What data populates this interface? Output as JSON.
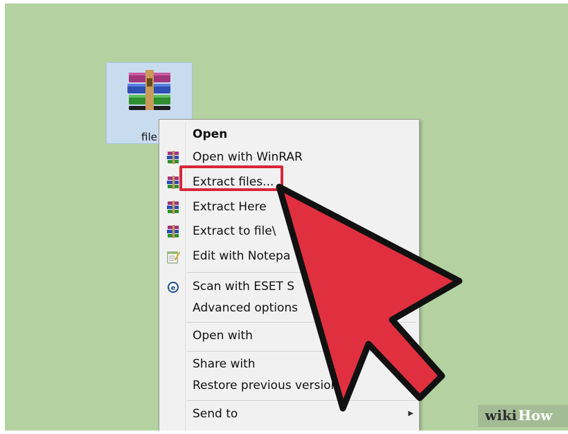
{
  "file": {
    "label": "file",
    "icon": "winrar-archive-icon"
  },
  "context_menu": {
    "items": [
      {
        "label": "Open",
        "bold": true,
        "icon": ""
      },
      {
        "label": "Open with WinRAR",
        "icon": "winrar-icon"
      },
      {
        "label": "Extract files...",
        "icon": "winrar-icon",
        "highlighted": true
      },
      {
        "label": "Extract Here",
        "icon": "winrar-icon"
      },
      {
        "label": "Extract to file\\",
        "icon": "winrar-icon"
      },
      {
        "label": "Edit with Notepa",
        "icon": "notepad-icon"
      },
      {
        "label": "Scan with ESET S",
        "icon": "eset-icon"
      },
      {
        "label": "Advanced options",
        "icon": "",
        "submenu": true
      },
      {
        "label": "Open with",
        "icon": ""
      },
      {
        "label": "Share with",
        "icon": ""
      },
      {
        "label": "Restore previous versions",
        "icon": ""
      },
      {
        "label": "Send to",
        "icon": "",
        "submenu": true
      }
    ]
  },
  "colors": {
    "background": "#b4d2a0",
    "highlight": "#d8263a",
    "cursor": "#e03040"
  },
  "brand": {
    "part1": "wiki",
    "part2": "How"
  }
}
